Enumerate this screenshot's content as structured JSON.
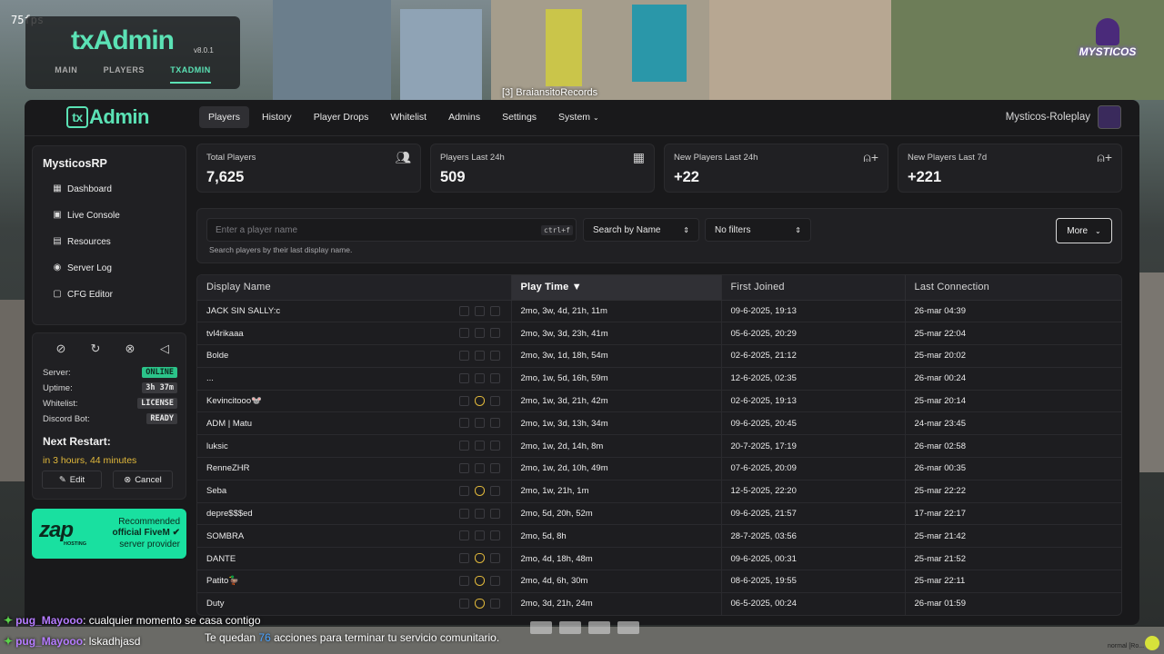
{
  "overlay": {
    "fps": "75fps",
    "mini_logo": "txAdmin",
    "mini_version": "v8.0.1",
    "mini_tabs": [
      "MAIN",
      "PLAYERS",
      "TXADMIN"
    ],
    "streamer_tag": "[3] BraiansitoRecords",
    "brand": "MYSTICOS",
    "chat": [
      {
        "user": "pug_Mayooo",
        "text": ": cualquier momento se casa contigo"
      },
      {
        "user": "pug_Mayooo",
        "text": ": lskadhjasd"
      }
    ],
    "subtitle_pre": "Te quedan ",
    "subtitle_num": "76",
    "subtitle_post": " acciones para terminar tu servicio comunitario.",
    "bottom_right": "normal [Ro..."
  },
  "header": {
    "logo": "Admin",
    "logo_box": "tx",
    "nav": [
      "Players",
      "History",
      "Player Drops",
      "Whitelist",
      "Admins",
      "Settings",
      "System"
    ],
    "active_nav": "Players",
    "server_name": "Mysticos-Roleplay"
  },
  "sidebar": {
    "server_title": "MysticosRP",
    "items": [
      {
        "label": "Dashboard",
        "icon": "dashboard-icon"
      },
      {
        "label": "Live Console",
        "icon": "console-icon"
      },
      {
        "label": "Resources",
        "icon": "resources-icon"
      },
      {
        "label": "Server Log",
        "icon": "eye-icon"
      },
      {
        "label": "CFG Editor",
        "icon": "file-icon"
      }
    ],
    "controls": [
      "power-off-icon",
      "restart-icon",
      "no-entry-icon",
      "megaphone-icon"
    ],
    "status": [
      {
        "label": "Server:",
        "value": "ONLINE"
      },
      {
        "label": "Uptime:",
        "value": "3h 37m"
      },
      {
        "label": "Whitelist:",
        "value": "LICENSE"
      },
      {
        "label": "Discord Bot:",
        "value": "READY"
      }
    ],
    "next_restart_title": "Next Restart:",
    "next_restart_time": "in 3 hours, 44 minutes",
    "edit_label": "Edit",
    "cancel_label": "Cancel"
  },
  "promo": {
    "logo": "zap",
    "sub": "HOSTING",
    "line1": "Recommended",
    "line2": "official FiveM",
    "line3": "server provider"
  },
  "stats": [
    {
      "label": "Total Players",
      "value": "7,625",
      "icon": "users-icon"
    },
    {
      "label": "Players Last 24h",
      "value": "509",
      "icon": "calendar-icon"
    },
    {
      "label": "New Players Last 24h",
      "value": "+22",
      "icon": "user-plus-icon"
    },
    {
      "label": "New Players Last 7d",
      "value": "+221",
      "icon": "user-plus-icon"
    }
  ],
  "search": {
    "placeholder": "Enter a player name",
    "shortcut": "ctrl+f",
    "hint": "Search players by their last display name.",
    "search_by": "Search by Name",
    "filters": "No filters",
    "more": "More"
  },
  "table": {
    "columns": [
      "Display Name",
      "Play Time ▼",
      "First Joined",
      "Last Connection"
    ],
    "sorted_column": 1,
    "rows": [
      {
        "name": "JACK SIN SALLY:c",
        "admin": false,
        "play": "2mo, 3w, 4d, 21h, 11m",
        "joined": "09-6-2025, 19:13",
        "last": "26-mar 04:39"
      },
      {
        "name": "tvl4rikaaa",
        "admin": false,
        "play": "2mo, 3w, 3d, 23h, 41m",
        "joined": "05-6-2025, 20:29",
        "last": "25-mar 22:04"
      },
      {
        "name": "Bolde",
        "admin": false,
        "play": "2mo, 3w, 1d, 18h, 54m",
        "joined": "02-6-2025, 21:12",
        "last": "25-mar 20:02"
      },
      {
        "name": "...",
        "admin": false,
        "play": "2mo, 1w, 5d, 16h, 59m",
        "joined": "12-6-2025, 02:35",
        "last": "26-mar 00:24"
      },
      {
        "name": "Kevincitooo🐭",
        "admin": true,
        "play": "2mo, 1w, 3d, 21h, 42m",
        "joined": "02-6-2025, 19:13",
        "last": "25-mar 20:14"
      },
      {
        "name": "ADM | Matu",
        "admin": false,
        "play": "2mo, 1w, 3d, 13h, 34m",
        "joined": "09-6-2025, 20:45",
        "last": "24-mar 23:45"
      },
      {
        "name": "luksic",
        "admin": false,
        "play": "2mo, 1w, 2d, 14h, 8m",
        "joined": "20-7-2025, 17:19",
        "last": "26-mar 02:58"
      },
      {
        "name": "RenneZHR",
        "admin": false,
        "play": "2mo, 1w, 2d, 10h, 49m",
        "joined": "07-6-2025, 20:09",
        "last": "26-mar 00:35"
      },
      {
        "name": "Seba",
        "admin": true,
        "play": "2mo, 1w, 21h, 1m",
        "joined": "12-5-2025, 22:20",
        "last": "25-mar 22:22"
      },
      {
        "name": "depre$$$ed",
        "admin": false,
        "play": "2mo, 5d, 20h, 52m",
        "joined": "09-6-2025, 21:57",
        "last": "17-mar 22:17"
      },
      {
        "name": "SOMBRA",
        "admin": false,
        "play": "2mo, 5d, 8h",
        "joined": "28-7-2025, 03:56",
        "last": "25-mar 21:42"
      },
      {
        "name": "DANTE",
        "admin": true,
        "play": "2mo, 4d, 18h, 48m",
        "joined": "09-6-2025, 00:31",
        "last": "25-mar 21:52"
      },
      {
        "name": "Patito🦆",
        "admin": true,
        "play": "2mo, 4d, 6h, 30m",
        "joined": "08-6-2025, 19:55",
        "last": "25-mar 22:11"
      },
      {
        "name": "Duty",
        "admin": true,
        "play": "2mo, 3d, 21h, 24m",
        "joined": "06-5-2025, 00:24",
        "last": "26-mar 01:59"
      }
    ]
  },
  "colors": {
    "accent": "#5be2b5",
    "online": "#2bc48a",
    "warning": "#e2b93b",
    "panel": "#19191b"
  }
}
